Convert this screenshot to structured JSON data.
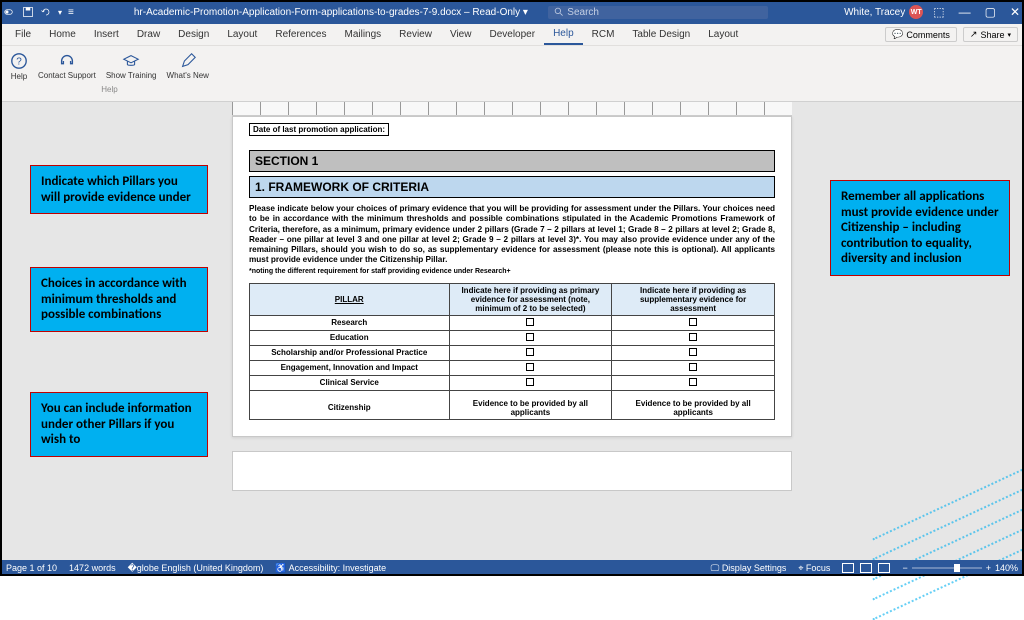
{
  "titlebar": {
    "doc_title": "hr-Academic-Promotion-Application-Form-applications-to-grades-7-9.docx – Read-Only ▾",
    "search_placeholder": "Search",
    "user_name": "White, Tracey",
    "user_initials": "WT"
  },
  "ribbon": {
    "tabs": [
      "File",
      "Home",
      "Insert",
      "Draw",
      "Design",
      "Layout",
      "References",
      "Mailings",
      "Review",
      "View",
      "Developer",
      "Help",
      "RCM",
      "Table Design",
      "Layout"
    ],
    "active_tab": "Help",
    "right": {
      "comments": "Comments",
      "share": "Share"
    },
    "help_group": {
      "label": "Help",
      "buttons": [
        {
          "label": "Help",
          "icon": "help-circle"
        },
        {
          "label": "Contact Support",
          "icon": "headset"
        },
        {
          "label": "Show Training",
          "icon": "grad-cap"
        },
        {
          "label": "What's New",
          "icon": "pencil"
        }
      ]
    }
  },
  "document": {
    "cut_row": "Date of last promotion application:",
    "section_title": "SECTION 1",
    "framework_title": "1. FRAMEWORK OF CRITERIA",
    "intro": "Please indicate below your choices of primary evidence that you will be providing for assessment under the Pillars.  Your choices need to be in accordance with the minimum thresholds and possible combinations stipulated in the Academic Promotions Framework of Criteria, therefore, as a minimum, primary evidence under 2 pillars (Grade 7 – 2 pillars at level 1; Grade 8 – 2 pillars at level 2; Grade 8, Reader – one pillar at level 3 and one pillar at level 2; Grade 9 – 2 pillars at level 3)*.  You may also provide evidence under any of the remaining Pillars, should you wish to do so, as supplementary evidence for assessment (please note this is optional).  All applicants must provide evidence under the Citizenship Pillar.",
    "footnote": "*noting the different requirement for staff providing evidence under Research+",
    "table": {
      "headers": [
        "PILLAR",
        "Indicate here if providing as primary evidence for assessment (note, minimum of 2 to be selected)",
        "Indicate here if providing as supplementary evidence for assessment"
      ],
      "rows": [
        {
          "name": "Research",
          "primary": "checkbox",
          "supp": "checkbox"
        },
        {
          "name": "Education",
          "primary": "checkbox",
          "supp": "checkbox"
        },
        {
          "name": "Scholarship and/or Professional Practice",
          "primary": "checkbox",
          "supp": "checkbox"
        },
        {
          "name": "Engagement, Innovation and Impact",
          "primary": "checkbox",
          "supp": "checkbox"
        },
        {
          "name": "Clinical Service",
          "primary": "checkbox",
          "supp": "checkbox"
        },
        {
          "name": "Citizenship",
          "primary": "Evidence to be provided by all applicants",
          "supp": "Evidence to be provided by all applicants"
        }
      ]
    }
  },
  "callouts": {
    "c1": "Indicate which Pillars you will provide evidence under",
    "c2": "Choices in accordance with minimum thresholds and possible combinations",
    "c3": "You can include information under other Pillars if you wish to",
    "c4": "Remember all applications must provide evidence under Citizenship – including contribution to equality, diversity and inclusion"
  },
  "statusbar": {
    "page": "Page 1 of 10",
    "words": "1472 words",
    "lang": "English (United Kingdom)",
    "accessibility": "Accessibility: Investigate",
    "display_settings": "Display Settings",
    "focus": "Focus",
    "zoom": "140%"
  }
}
